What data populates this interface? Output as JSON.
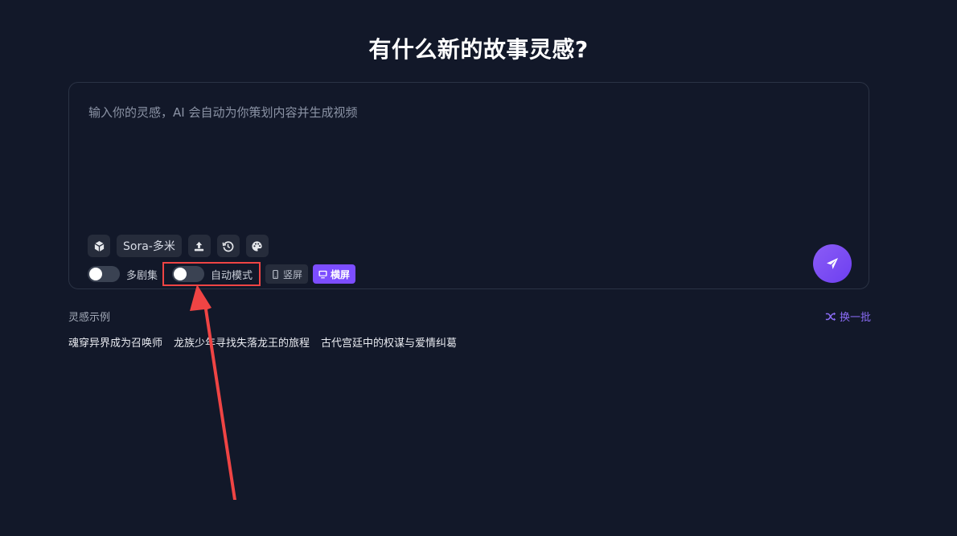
{
  "header": {
    "title": "有什么新的故事灵感?"
  },
  "prompt": {
    "placeholder": "输入你的灵感，AI 会自动为你策划内容并生成视频",
    "value": ""
  },
  "toolbar": {
    "model_label": "Sora-多米",
    "icons": [
      "cube-icon",
      "upload-icon",
      "history-icon",
      "palette-icon"
    ]
  },
  "options": {
    "multi_episode": {
      "label": "多剧集",
      "enabled": false
    },
    "auto_mode": {
      "label": "自动模式",
      "enabled": false
    },
    "portrait_label": "竖屏",
    "landscape_label": "横屏",
    "selected_orientation": "横屏"
  },
  "examples": {
    "label": "灵感示例",
    "refresh_label": "换一批",
    "items": [
      "魂穿异界成为召唤师",
      "龙族少年寻找失落龙王的旅程",
      "古代宫廷中的权谋与爱情纠葛"
    ]
  },
  "colors": {
    "background": "#121829",
    "accent": "#7c4dff",
    "highlight": "#ef4444"
  }
}
